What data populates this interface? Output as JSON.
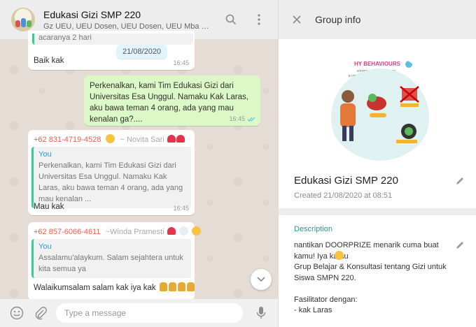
{
  "chat": {
    "title": "Edukasi Gizi SMP 220",
    "members": "Gz UEU, UEU Dosen, UEU Dosen, UEU Mba Nanda, +...",
    "date_pill": "21/08/2020",
    "messages": [
      {
        "kind": "in",
        "text_top": "acaranya 2 hari",
        "text": "Baik kak",
        "time": "16:45"
      },
      {
        "kind": "out",
        "text": "Perkenalkan, kami Tim Edukasi Gizi dari Universitas Esa Unggul. Namaku Kak Laras, aku bawa teman 4 orang, ada yang mau kenalan ga?....",
        "time": "16:45"
      },
      {
        "kind": "in",
        "phone": "+62 831-4719-4528",
        "name": "~ Novita Sari",
        "quote_name": "You",
        "quote_text": "Perkenalkan, kami Tim Edukasi Gizi dari Universitas Esa Unggul. Namaku Kak Laras, aku bawa teman 4 orang, ada yang mau kenalan ...",
        "text": "Mau kak",
        "time": "16:45"
      },
      {
        "kind": "in",
        "phone": "+62 857-6066-4611",
        "name": "~Winda Pramesti",
        "quote_name": "You",
        "quote_text": "Assalamu'alaykum. Salam sejahtera untuk kita semua ya",
        "text": "Walaikumsalam salam kak iya kak"
      }
    ],
    "composer_placeholder": "Type a message"
  },
  "info": {
    "header_title": "Group info",
    "group_name": "Edukasi Gizi SMP 220",
    "created": "Created 21/08/2020 at 08:51",
    "photo_text": [
      "HY BEHAVIOURS",
      "START IN ADOLESCENCE",
      "E HEALTHY ADULTS"
    ],
    "description_label": "Description",
    "description": "nantikan DOORPRIZE menarik cuma buat kamu! Iya kamu \nGrup Belajar & Konsultasi tentang Gizi untuk Siswa SMPN 220.\n\nFasilitator dengan:\n- kak Laras"
  },
  "colors": {
    "header_bg": "#ededed",
    "chat_bg": "#e5ddd5",
    "out_bubble": "#dcf8c6",
    "accent": "#2a9d8f"
  }
}
